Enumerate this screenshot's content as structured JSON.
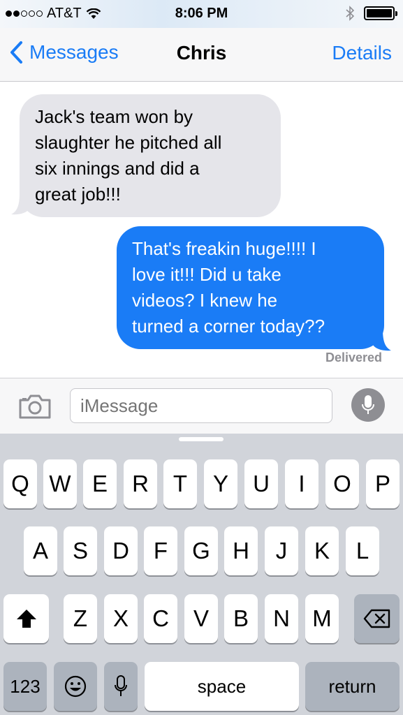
{
  "status_bar": {
    "carrier": "AT&T",
    "signal_bars_filled": 2,
    "signal_bars_total": 5,
    "time": "8:06 PM",
    "battery_level": 1.0
  },
  "nav": {
    "back_label": "Messages",
    "title": "Chris",
    "details_label": "Details"
  },
  "messages": [
    {
      "direction": "incoming",
      "text": "Jack's team won by\nslaughter he pitched all\nsix innings and did a\ngreat job!!!"
    },
    {
      "direction": "outgoing",
      "text": "That's freakin huge!!!! I\nlove it!!! Did u take\nvideos?  I knew he\nturned a corner today??"
    }
  ],
  "delivery_status": "Delivered",
  "composer": {
    "placeholder": "iMessage"
  },
  "keyboard": {
    "row1": [
      "Q",
      "W",
      "E",
      "R",
      "T",
      "Y",
      "U",
      "I",
      "O",
      "P"
    ],
    "row2": [
      "A",
      "S",
      "D",
      "F",
      "G",
      "H",
      "J",
      "K",
      "L"
    ],
    "row3": [
      "Z",
      "X",
      "C",
      "V",
      "B",
      "N",
      "M"
    ],
    "numbers_label": "123",
    "space_label": "space",
    "return_label": "return"
  },
  "colors": {
    "accent": "#1a7cf6",
    "incoming_bubble": "#e5e5ea",
    "keyboard_bg": "#d1d4da"
  }
}
